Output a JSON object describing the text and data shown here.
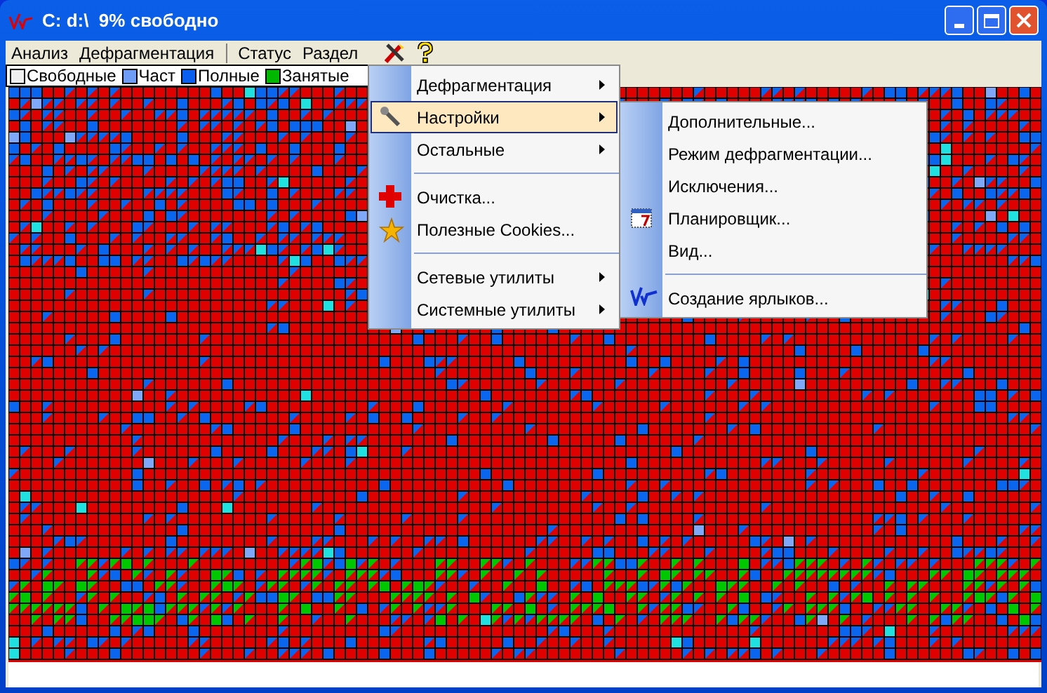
{
  "window": {
    "title": "C: d:\\  9% свободно"
  },
  "menu_bar": [
    {
      "kind": "text",
      "label": "Анализ"
    },
    {
      "kind": "text",
      "label": "Дефрагментация"
    },
    {
      "kind": "separator"
    },
    {
      "kind": "text",
      "label": "Статус"
    },
    {
      "kind": "text",
      "label": "Раздел"
    },
    {
      "kind": "tools"
    },
    {
      "kind": "help"
    }
  ],
  "legend": [
    {
      "label": "Свободные",
      "color": "#f0f0f0"
    },
    {
      "label": "Част",
      "color": "#6f9cf7"
    },
    {
      "label": "Полные",
      "color": "#0a5ef0"
    },
    {
      "label": "Занятые",
      "color": "#00b800"
    }
  ],
  "menu": [
    {
      "kind": "item",
      "label": "Дефрагментация",
      "submenu": true,
      "selected": false
    },
    {
      "kind": "item",
      "label": "Настройки",
      "submenu": true,
      "selected": true
    },
    {
      "kind": "item",
      "label": "Остальные",
      "submenu": true,
      "selected": false
    },
    {
      "kind": "separator"
    },
    {
      "kind": "item",
      "label": "Очистка...",
      "submenu": false,
      "selected": false
    },
    {
      "kind": "item",
      "label": "Полезные Cookies...",
      "submenu": false,
      "selected": false
    },
    {
      "kind": "separator"
    },
    {
      "kind": "item",
      "label": "Сетевые утилиты",
      "submenu": true,
      "selected": false
    },
    {
      "kind": "item",
      "label": "Системные утилиты",
      "submenu": true,
      "selected": false
    }
  ],
  "submenu": [
    {
      "kind": "item",
      "label": "Дополнительные..."
    },
    {
      "kind": "item",
      "label": "Режим дефрагментации..."
    },
    {
      "kind": "item",
      "label": "Исключения..."
    },
    {
      "kind": "item",
      "label": "Планировщик..."
    },
    {
      "kind": "item",
      "label": "Вид..."
    },
    {
      "kind": "separator"
    },
    {
      "kind": "item",
      "label": "Создание ярлыков..."
    }
  ]
}
